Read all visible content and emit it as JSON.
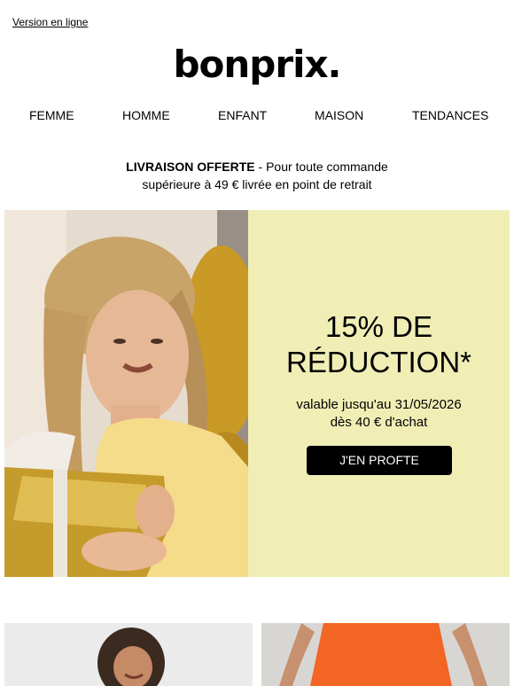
{
  "header": {
    "online_link": "Version en ligne",
    "logo": "bonprix."
  },
  "nav": [
    "FEMME",
    "HOMME",
    "ENFANT",
    "MAISON",
    "TENDANCES"
  ],
  "shipping": {
    "bold": "LIVRAISON OFFERTE",
    "rest": " - Pour toute commande",
    "line2": "supérieure à 49 € livrée en point de retrait"
  },
  "hero": {
    "title_line1": "15% DE",
    "title_line2": "RÉDUCTION*",
    "validity": "valable jusqu'au 31/05/2026",
    "minimum": "dès 40 € d'achat",
    "cta": "J'EN PROFTE",
    "panel_color": "#f0eeb5",
    "image_icon": "woman-with-gift-photo"
  },
  "tiles": [
    {
      "image_icon": "woman-smiling-photo"
    },
    {
      "image_icon": "orange-dress-photo"
    }
  ]
}
